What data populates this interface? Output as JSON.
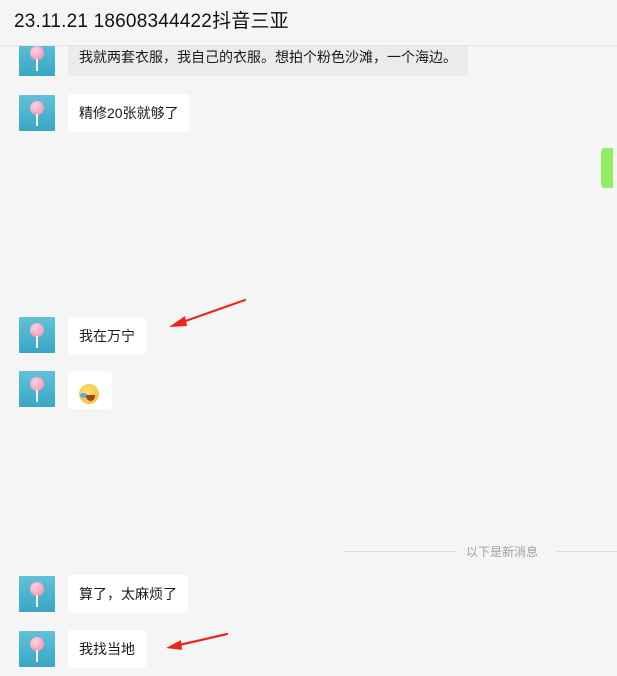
{
  "header": {
    "title": "23.11.21 18608344422抖音三亚"
  },
  "messages": [
    {
      "sender": "contact",
      "type": "text",
      "text": "我就两套衣服，我自己的衣服。想拍个粉色沙滩，一个海边。"
    },
    {
      "sender": "contact",
      "type": "text",
      "text": "精修20张就够了"
    },
    {
      "sender": "contact",
      "type": "text",
      "text": "我在万宁"
    },
    {
      "sender": "contact",
      "type": "emoji",
      "icon": "crying-laughing-emoji-icon"
    },
    {
      "sender": "contact",
      "type": "text",
      "text": "算了，太麻烦了"
    },
    {
      "sender": "contact",
      "type": "text",
      "text": "我找当地"
    }
  ],
  "divider": {
    "label": "以下是新消息"
  },
  "colors": {
    "background": "#f5f5f5",
    "bubble": "#ffffff",
    "highlight_bubble": "#ebebeb",
    "self_bubble": "#95ec69",
    "annotation_arrow": "#e8281e"
  }
}
